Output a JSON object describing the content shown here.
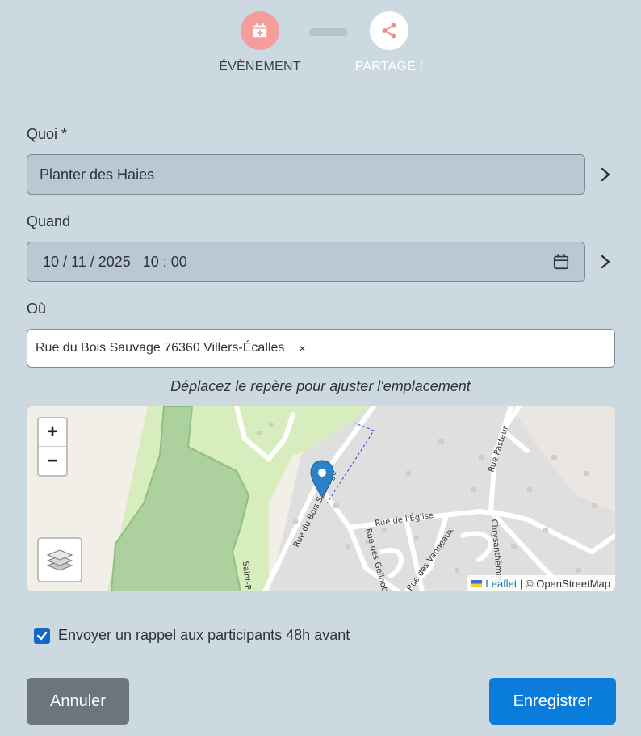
{
  "stepper": {
    "steps": [
      {
        "label": "ÉVÈNEMENT",
        "icon": "calendar-plus-icon",
        "state": "active"
      },
      {
        "label": "PARTAGE !",
        "icon": "share-icon",
        "state": "upcoming"
      }
    ]
  },
  "form": {
    "what": {
      "label": "Quoi *",
      "value": "Planter des Haies"
    },
    "when": {
      "label": "Quand",
      "value": "10 / 11 / 2025   10 : 00"
    },
    "where": {
      "label": "Où",
      "value": "Rue du Bois Sauvage 76360 Villers-Écalles",
      "clear": "×"
    },
    "hint": "Déplacez le repère pour ajuster l'emplacement"
  },
  "map": {
    "zoom_in": "+",
    "zoom_out": "−",
    "attribution_leaflet": "Leaflet",
    "attribution_sep": " | © ",
    "attribution_osm": "OpenStreetMap",
    "street_labels": [
      "Rue du Bois Sauvage",
      "Rue de l'Église",
      "Rue des Gélinottes",
      "Rue des Vanneaux",
      "Rue Pasteur",
      "Chrysanthèmes",
      "Saint-P"
    ]
  },
  "reminder": {
    "label": "Envoyer un rappel aux participants 48h avant",
    "checked": true
  },
  "buttons": {
    "cancel": "Annuler",
    "save": "Enregistrer"
  },
  "colors": {
    "background": "#cdd9e1",
    "step_active": "#f59c9c",
    "primary": "#0a7ddb",
    "secondary": "#6c757d",
    "checkbox": "#1666c5",
    "marker": "#2a82cb"
  }
}
